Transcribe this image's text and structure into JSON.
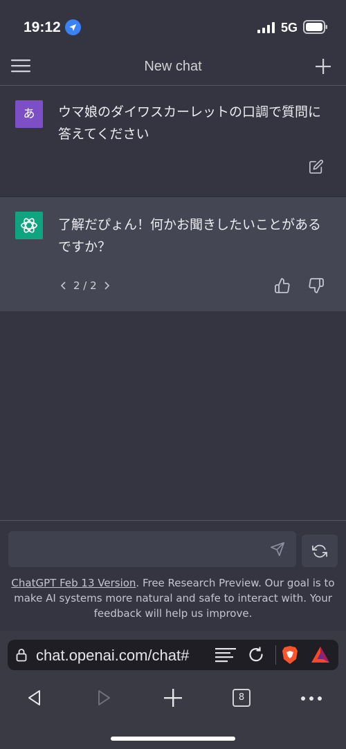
{
  "status": {
    "time": "19:12",
    "network": "5G"
  },
  "header": {
    "title": "New chat"
  },
  "conversation": {
    "user": {
      "avatar_text": "あ",
      "avatar_color": "#7c4fc4",
      "text": "ウマ娘のダイワスカーレットの口調で質問に答えてください"
    },
    "assistant": {
      "avatar_color": "#10a37f",
      "text": "了解だぴょん！何かお聞きしたいことがあるですか？",
      "pager": "2 / 2"
    }
  },
  "composer": {
    "input_value": "",
    "disclaimer_link": "ChatGPT Feb 13 Version",
    "disclaimer_rest": ". Free Research Preview. Our goal is to make AI systems more natural and safe to interact with. Your feedback will help us improve."
  },
  "browser": {
    "url": "chat.openai.com/chat#",
    "tab_count": "8"
  },
  "colors": {
    "background": "#343541",
    "assistant_row": "#444654",
    "input": "#40414f",
    "browser_chrome": "#3a3a45"
  }
}
